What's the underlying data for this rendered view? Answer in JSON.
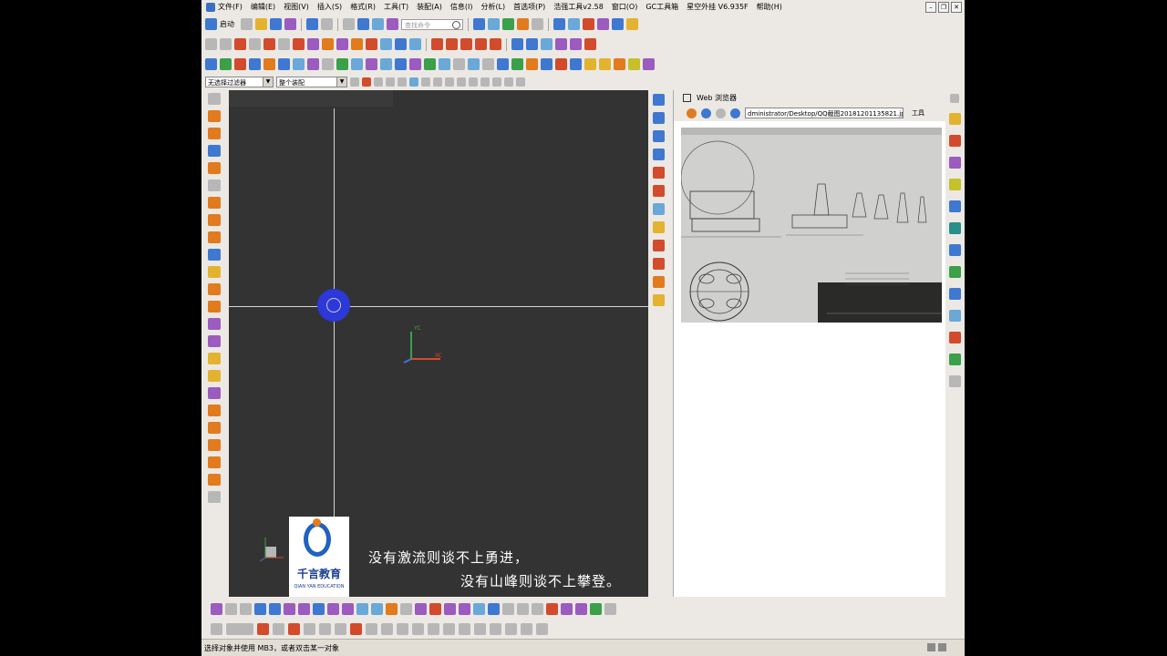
{
  "menubar": {
    "items": [
      "文件(F)",
      "编辑(E)",
      "视图(V)",
      "插入(S)",
      "格式(R)",
      "工具(T)",
      "装配(A)",
      "信息(I)",
      "分析(L)",
      "首选项(P)",
      "浩强工具v2.58",
      "窗口(O)",
      "GC工具箱",
      "星空外挂 V6.935F",
      "帮助(H)"
    ]
  },
  "toolbar": {
    "start_label": "启动",
    "search_placeholder": "查找命令",
    "filter_value": "无选择过滤器",
    "assembly_value": "整个装配"
  },
  "web_panel": {
    "title": "Web 浏览器",
    "url": "dministrator/Desktop/QQ截图20181201135821.jpg",
    "tools_label": "工具"
  },
  "statusbar": {
    "message": "选择对象并使用 MB3，或者双击某一对象"
  },
  "overlay": {
    "logo_cn": "千言教育",
    "logo_en": "QIAN YAN EDUCATION",
    "subtitle_line1": "没有激流则谈不上勇进，",
    "subtitle_line2": "没有山峰则谈不上攀登。"
  },
  "viewport": {
    "axis_labels": {
      "y": "YC",
      "x": "XC"
    },
    "background_color": "#333333",
    "cursor_color": "#2c38d8"
  }
}
